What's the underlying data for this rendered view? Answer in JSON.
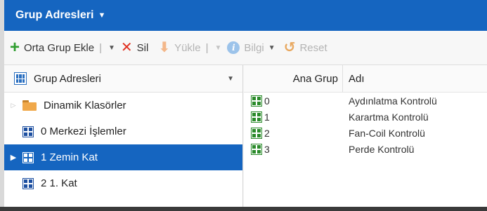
{
  "header": {
    "title": "Grup Adresleri"
  },
  "toolbar": {
    "add_label": "Orta Grup Ekle",
    "delete_label": "Sil",
    "upload_label": "Yükle",
    "info_label": "Bilgi",
    "reset_label": "Reset",
    "separator": "|"
  },
  "tree": {
    "header_label": "Grup Adresleri",
    "items": [
      {
        "label": "Dinamik Klasörler"
      },
      {
        "label": "0 Merkezi İşlemler"
      },
      {
        "label": "1 Zemin Kat"
      },
      {
        "label": "2 1. Kat"
      }
    ]
  },
  "table": {
    "columns": [
      "Ana Grup",
      "Adı"
    ],
    "rows": [
      {
        "number": "0",
        "name": "Aydınlatma Kontrolü"
      },
      {
        "number": "1",
        "name": "Karartma Kontrolü"
      },
      {
        "number": "2",
        "name": "Fan-Coil Kontrolü"
      },
      {
        "number": "3",
        "name": "Perde Kontrolü"
      }
    ]
  },
  "colors": {
    "accent": "#1565c0",
    "add": "#2e9d2e",
    "delete": "#e03020"
  }
}
